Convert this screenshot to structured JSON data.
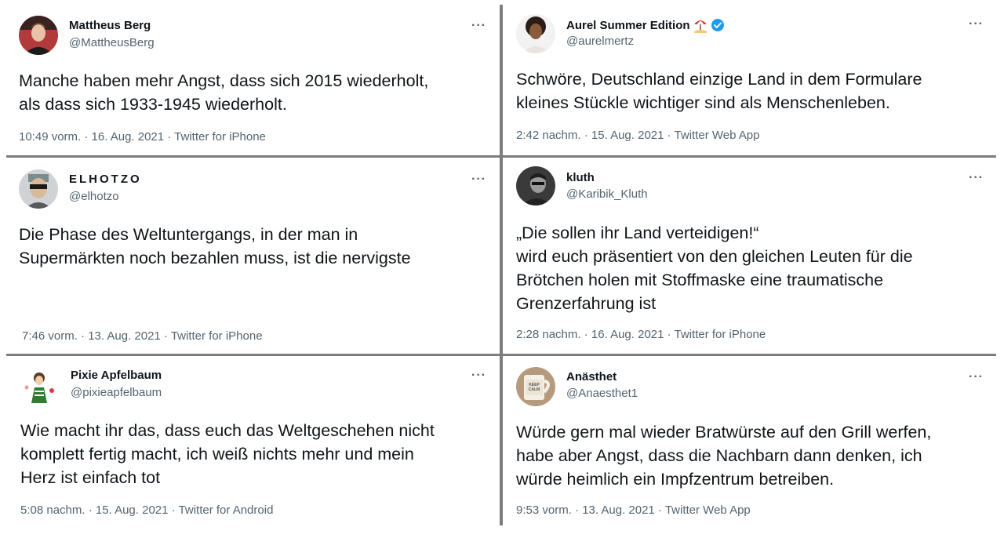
{
  "tweets": [
    {
      "name": "Mattheus Berg",
      "handle": "@MattheusBerg",
      "text": "Manche haben mehr Angst, dass sich 2015 wiederholt,\nals dass sich 1933-1945 wiederholt.",
      "meta": "10:49 vorm. · 16. Aug. 2021 · Twitter for iPhone",
      "more": "···"
    },
    {
      "name": "Aurel Summer Edition",
      "handle": "@aurelmertz",
      "text": "Schwöre, Deutschland einzige Land in dem Formulare\nkleines Stückle wichtiger sind als Menschenleben.",
      "meta": "2:42 nachm. · 15. Aug. 2021 · Twitter Web App",
      "more": "···",
      "emoji_icon": "beach-umbrella-icon",
      "badge_icon": "verified-badge-icon"
    },
    {
      "name": "ELHOTZO",
      "handle": "@elhotzo",
      "text": "Die Phase des Weltuntergangs, in der man in\nSupermärkten noch bezahlen muss, ist die nervigste",
      "meta": "7:46 vorm. · 13. Aug. 2021 · Twitter for iPhone",
      "more": "···"
    },
    {
      "name": "kluth",
      "handle": "@Karibik_Kluth",
      "text": "„Die sollen ihr Land verteidigen!“\nwird euch präsentiert von den gleichen Leuten für die\nBrötchen holen mit Stoffmaske eine traumatische\nGrenzerfahrung ist",
      "meta": "2:28 nachm. · 16. Aug. 2021 · Twitter for iPhone",
      "more": "···"
    },
    {
      "name": "Pixie Apfelbaum",
      "handle": "@pixieapfelbaum",
      "text": "Wie macht ihr das, dass euch das Weltgeschehen nicht\nkomplett fertig macht, ich weiß nichts mehr und mein\nHerz ist einfach tot",
      "meta": "5:08 nachm. · 15. Aug. 2021 · Twitter for Android",
      "more": "···"
    },
    {
      "name": "Anästhet",
      "handle": "@Anaesthet1",
      "text": "Würde gern mal wieder Bratwürste auf den Grill werfen,\nhabe aber Angst, dass die Nachbarn dann denken, ich\nwürde heimlich ein Impfzentrum betreiben.",
      "meta": "9:53 vorm. · 13. Aug. 2021 · Twitter Web App",
      "more": "···",
      "avatar_text": "KEEP CALM"
    }
  ],
  "colors": {
    "text": "#0f1419",
    "secondary": "#536471",
    "divider": "#7d7d7d",
    "verified": "#1d9bf0"
  }
}
